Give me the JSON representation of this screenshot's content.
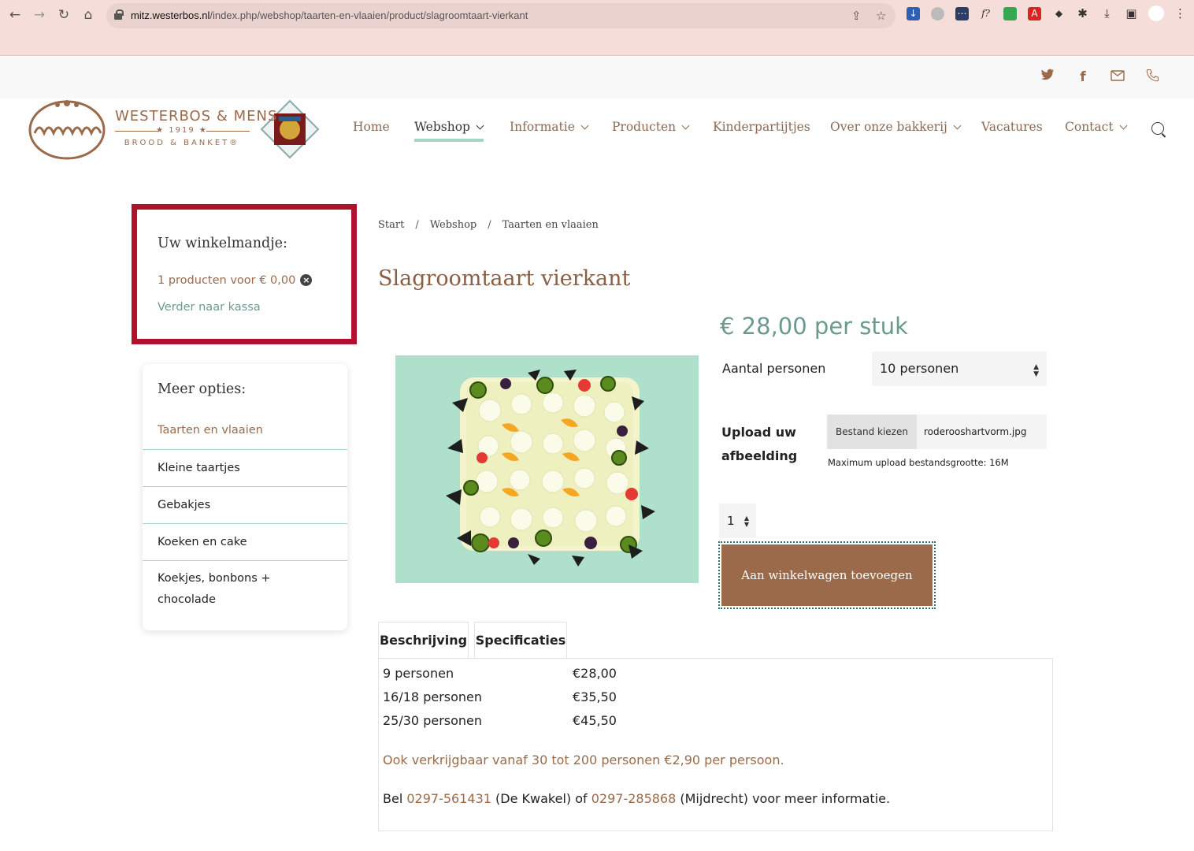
{
  "browser": {
    "url_host": "mitz.westerbos.nl",
    "url_path": "/index.php/webshop/taarten-en-vlaaien/product/slagroomtaart-vierkant"
  },
  "logo": {
    "brand": "WESTERBOS & MENS",
    "year": "★ 1919 ★",
    "tagline": "BROOD & BANKET®"
  },
  "nav": {
    "items": [
      "Home",
      "Webshop",
      "Informatie",
      "Producten",
      "Kinderpartijtjes",
      "Over onze bakkerij",
      "Vacatures",
      "Contact"
    ],
    "active": "Webshop"
  },
  "cart": {
    "title": "Uw winkelmandje:",
    "summary": "1 producten voor € 0,00",
    "checkout": "Verder naar kassa"
  },
  "options": {
    "title": "Meer opties:",
    "items": [
      "Taarten en vlaaien",
      "Kleine taartjes",
      "Gebakjes",
      "Koeken en cake",
      "Koekjes, bonbons +",
      "chocolade"
    ]
  },
  "breadcrumb": [
    "Start",
    "/",
    "Webshop",
    "/",
    "Taarten en vlaaien"
  ],
  "product": {
    "title": "Slagroomtaart vierkant",
    "price": "€ 28,00 per stuk",
    "persons_label": "Aantal personen",
    "persons_value": "10 personen",
    "upload_label_1": "Upload uw",
    "upload_label_2": "afbeelding",
    "file_button": "Bestand kiezen",
    "file_name": "roderooshartvorm.jpg",
    "upload_note": "Maximum upload bestandsgrootte: 16M",
    "quantity": "1",
    "add_to_cart": "Aan winkelwagen toevoegen"
  },
  "tabs": [
    "Beschrijving",
    "Specificaties"
  ],
  "specs": [
    {
      "persons": "9 personen",
      "price": "€28,00"
    },
    {
      "persons": "16/18 personen",
      "price": "€35,50"
    },
    {
      "persons": "25/30 personen",
      "price": "€45,50"
    }
  ],
  "notes": {
    "availability": "Ook verkrijgbaar vanaf 30 tot 200 personen €2,90 per persoon.",
    "call_prefix": "Bel ",
    "phone1": "0297-561431",
    "loc1": " (De Kwakel) of ",
    "phone2": "0297-285868",
    "loc2": " (Mijdrecht) voor meer informatie."
  },
  "colors": {
    "brand_brown": "#9a6a4b",
    "accent_green": "#6b9a8d",
    "highlight_red": "#b0112c",
    "underline_mint": "#a6d5c3"
  }
}
